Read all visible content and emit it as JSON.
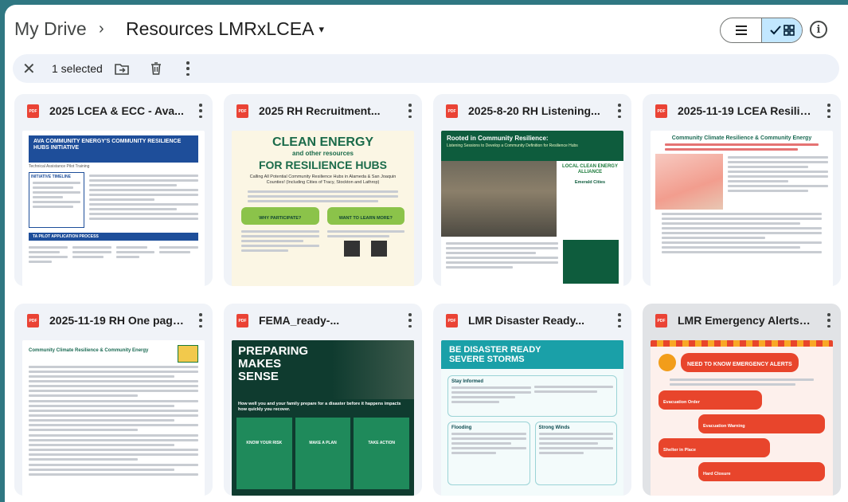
{
  "header": {
    "root": "My Drive",
    "separator": "›",
    "current": "Resources LMRxLCEA",
    "caret": "▾"
  },
  "selection": {
    "count_label": "1 selected",
    "icons": [
      "close-icon",
      "move-to-folder-icon",
      "trash-icon",
      "more-vert-icon"
    ]
  },
  "view": {
    "mode": "grid"
  },
  "files": [
    {
      "title": "2025 LCEA & ECC - Ava...",
      "file_type": "PDF",
      "thumb": {
        "heading": "AVA COMMUNITY ENERGY'S COMMUNITY RESILIENCE HUBS INITIATIVE",
        "sub": "Technical Assistance Pilot Training",
        "box1": "INITIATIVE TIMELINE",
        "box2": "TA PILOT APPLICATION PROCESS",
        "color": "#1e4e9a"
      }
    },
    {
      "title": "2025 RH Recruitment...",
      "file_type": "PDF",
      "thumb": {
        "line1": "CLEAN ENERGY",
        "line2": "and other resources",
        "line3": "FOR RESILIENCE HUBS",
        "sub": "Calling All Potential Community Resilience Hubs in Alameda & San Joaquin Counties! (Including Cities of Tracy, Stockton and Lathrop)",
        "btn1": "WHY PARTICIPATE?",
        "btn2": "WANT TO LEARN MORE?",
        "color": "#1b6b4a"
      }
    },
    {
      "title": "2025-8-20 RH Listening...",
      "file_type": "PDF",
      "thumb": {
        "heading": "Rooted in Community Resilience:",
        "sub": "Listening Sessions to Develop a Community Definition for Resilience Hubs",
        "logo1": "LOCAL CLEAN ENERGY ALLIANCE",
        "logo2": "Emerald Cities",
        "color": "#0e5c3d"
      }
    },
    {
      "title": "2025-11-19 LCEA Resilien...",
      "file_type": "PDF",
      "thumb": {
        "heading": "Community Climate Resilience & Community Energy",
        "color": "#1c6b54"
      }
    },
    {
      "title": "2025-11-19 RH One pager...",
      "file_type": "PDF",
      "thumb": {
        "heading": "Community Climate Resilience & Community Energy",
        "color": "#1c6b54"
      }
    },
    {
      "title": "FEMA_ready-...",
      "file_type": "PDF",
      "thumb": {
        "line1": "PREPARING",
        "line2": "MAKES",
        "line3": "SENSE",
        "sub": "How well you and your family prepare for a disaster before it happens impacts how quickly you recover.",
        "col1": "KNOW YOUR RISK",
        "col2": "MAKE A PLAN",
        "col3": "TAKE ACTION",
        "color": "#0f3b2f"
      }
    },
    {
      "title": "LMR Disaster Ready...",
      "file_type": "PDF",
      "thumb": {
        "line1": "BE DISASTER READY",
        "line2": "SEVERE STORMS",
        "s1": "Stay Informed",
        "s2": "Flooding",
        "s3": "Strong Winds",
        "color": "#1aa0a8"
      }
    },
    {
      "title": "LMR Emergency Alerts.pdf",
      "file_type": "PDF",
      "selected": true,
      "thumb": {
        "heading": "NEED TO KNOW EMERGENCY ALERTS",
        "r1": "Evacuation Order",
        "r2": "Evacuation Warning",
        "r3": "Shelter in Place",
        "r4": "Hard Closure",
        "color": "#e8452c"
      }
    }
  ]
}
